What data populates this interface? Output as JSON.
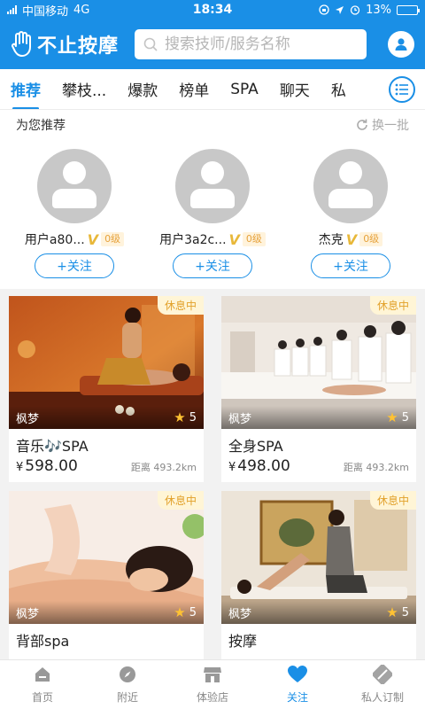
{
  "status_bar": {
    "carrier": "中国移动",
    "network": "4G",
    "time": "18:34",
    "battery": "13%",
    "battery_level": 0.13
  },
  "header": {
    "app_name": "不止按摩",
    "search_placeholder": "搜索技师/服务名称",
    "brand_color": "#1a8fe6"
  },
  "tabs": [
    {
      "label": "推荐",
      "active": true
    },
    {
      "label": "攀枝..."
    },
    {
      "label": "爆款"
    },
    {
      "label": "榜单"
    },
    {
      "label": "SPA"
    },
    {
      "label": "聊天"
    },
    {
      "label": "私"
    }
  ],
  "recommend": {
    "title": "为您推荐",
    "refresh_label": "换一批",
    "users": [
      {
        "name": "用户a80...",
        "v_mark": "V",
        "level": "0级",
        "follow_label": "+关注"
      },
      {
        "name": "用户3a2c...",
        "v_mark": "V",
        "level": "0级",
        "follow_label": "+关注"
      },
      {
        "name": "杰克",
        "v_mark": "V",
        "level": "0级",
        "follow_label": "+关注"
      }
    ]
  },
  "services": [
    {
      "badge": "休息中",
      "shop": "枫梦",
      "rating": "5",
      "title": "音乐🎶SPA",
      "currency": "¥",
      "price": "598.00",
      "distance": "距离 493.2km"
    },
    {
      "badge": "休息中",
      "shop": "枫梦",
      "rating": "5",
      "title": "全身SPA",
      "currency": "¥",
      "price": "498.00",
      "distance": "距离 493.2km"
    },
    {
      "badge": "休息中",
      "shop": "枫梦",
      "rating": "5",
      "title": "背部spa"
    },
    {
      "badge": "休息中",
      "shop": "枫梦",
      "rating": "5",
      "title": "按摩"
    }
  ],
  "bottom_nav": [
    {
      "label": "首页",
      "icon": "home-icon"
    },
    {
      "label": "附近",
      "icon": "compass-icon"
    },
    {
      "label": "体验店",
      "icon": "store-icon"
    },
    {
      "label": "关注",
      "icon": "heart-icon",
      "active": true
    },
    {
      "label": "私人订制",
      "icon": "custom-icon"
    }
  ]
}
